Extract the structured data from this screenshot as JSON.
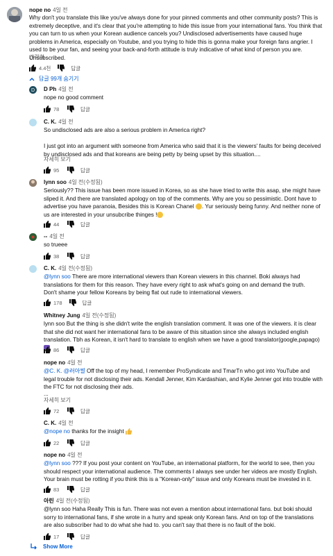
{
  "top": {
    "author": "nope no",
    "time": "4일 전",
    "text": "Why don't you translate this like you've always done for your pinned comments and other community posts? This is extremely deceptive, and it's clear that you're attempting to hide this issue from your international fans. You think that you can turn to us when your Korean audience cancels you? Undisclosed advertisements have caused huge problems in America, especially on Youtube, and you trying to hide this is gonna make your foreign fans angrier. I used to be your fan, and seeing your back-and-forth attitude is truly indicative of what kind of person you are. Unsubscribed.",
    "show_less": "간략히",
    "likes": "4.4천",
    "reply_label": "답글"
  },
  "replies_toggle": "답글 99개 숨기기",
  "replies": [
    {
      "author": "D Ph",
      "time": "4일 전",
      "lines": [
        "nope no good comment"
      ],
      "likes": "78",
      "reply": "답글"
    },
    {
      "author": "C. K.",
      "time": "4일 전",
      "lines": [
        "So undisclosed ads are also a serious problem in America right?",
        "",
        "I just got into an argument with someone from America who said that it is the viewers' faults for being deceived by undisclosed ads and that koreans are being petty by being upset by this situation...."
      ],
      "read_more": "자세히 보기",
      "likes": "95",
      "reply": "답글"
    },
    {
      "author": "lynn soo",
      "time": "4일 전(수정됨)",
      "lines": [
        "Seriously?? This issue has been more issued in Korea, so as she  have tried to write this asap, she might have sliped it. And there are translated apology on top of the comments. Why are you so pessimistic. Dont have to advertise you have paranoia, Besides this is Korean Chanel",
        "Yur seriously being funny. And neither none of us are interested in your unsubcribe thinges !"
      ],
      "likes": "44",
      "reply": "답글"
    },
    {
      "author": "--",
      "time": "4일 전",
      "lines": [
        "so trueee"
      ],
      "likes": "38",
      "reply": "답글"
    },
    {
      "author": "C. K.",
      "time": "4일 전(수정됨)",
      "mention": "@lynn soo",
      "lines": [
        " There are more international viewers than Korean viewers in this channel. Boki always had translations for them for this reason. They have every right to ask what's going on and demand the truth.",
        "Don't shame your fellow Koreans by being flat out rude to international viewers."
      ],
      "likes": "178",
      "reply": "답글"
    },
    {
      "author": "Whitney Jung",
      "time": "4일 전(수정됨)",
      "lines": [
        "lynn soo But the thing is she didn't write the english translation comment. It was one of the viewers. it is clear that she did not want her international fans to be aware of this situation since she always included english translation. Tbh as Korean, it isn't hard to translate to english when we have a good translator(google,papago)"
      ],
      "likes": "86",
      "reply": "답글"
    },
    {
      "author": "nope no",
      "time": "4일 전",
      "mention": "@C. K.",
      "mention2": "@러아썰",
      "lines": [
        "  Off the top of my head, I remember ProSyndicate and TmarTn who got into YouTube and legal trouble for not disclosing their ads. Kendall Jenner, Kim Kardashian, and Kylie Jenner got into trouble with the FTC for not disclosing their ads.",
        "..."
      ],
      "read_more": "자세히 보기",
      "likes": "72",
      "reply": "답글"
    },
    {
      "author": "C. K.",
      "time": "4일 전",
      "mention": "@nope no",
      "lines": [
        " thanks for the insight "
      ],
      "likes": "22",
      "reply": "답글"
    },
    {
      "author": "nope no",
      "time": "4일 전",
      "mention": "@lynn soo",
      "lines": [
        " ??? If you post your content on YouTube, an international platform, for the world to see, then you should respect your international audience. The comments I always see under her videos are mostly English. Your brain must be rotting if you think this is a \"Korean-only\" issue and only Koreans must be invested in it."
      ],
      "likes": "83",
      "reply": "답글"
    },
    {
      "author": "아린",
      "time": "4일 전(수정됨)",
      "lines": [
        "@lynn soo Haha Really This is fun. There was not even a mention about international fans. but boki should sorry to international fans, if she wrote in a hurry and speak only Korean fans. And on top of the translations are also subscriber had to do what she had to. you can't say that there is no fault of the boki."
      ],
      "likes": "17",
      "reply": "답글"
    }
  ],
  "show_more": "Show More",
  "colors": {
    "accent": "#065fd4",
    "muted": "#606060"
  }
}
